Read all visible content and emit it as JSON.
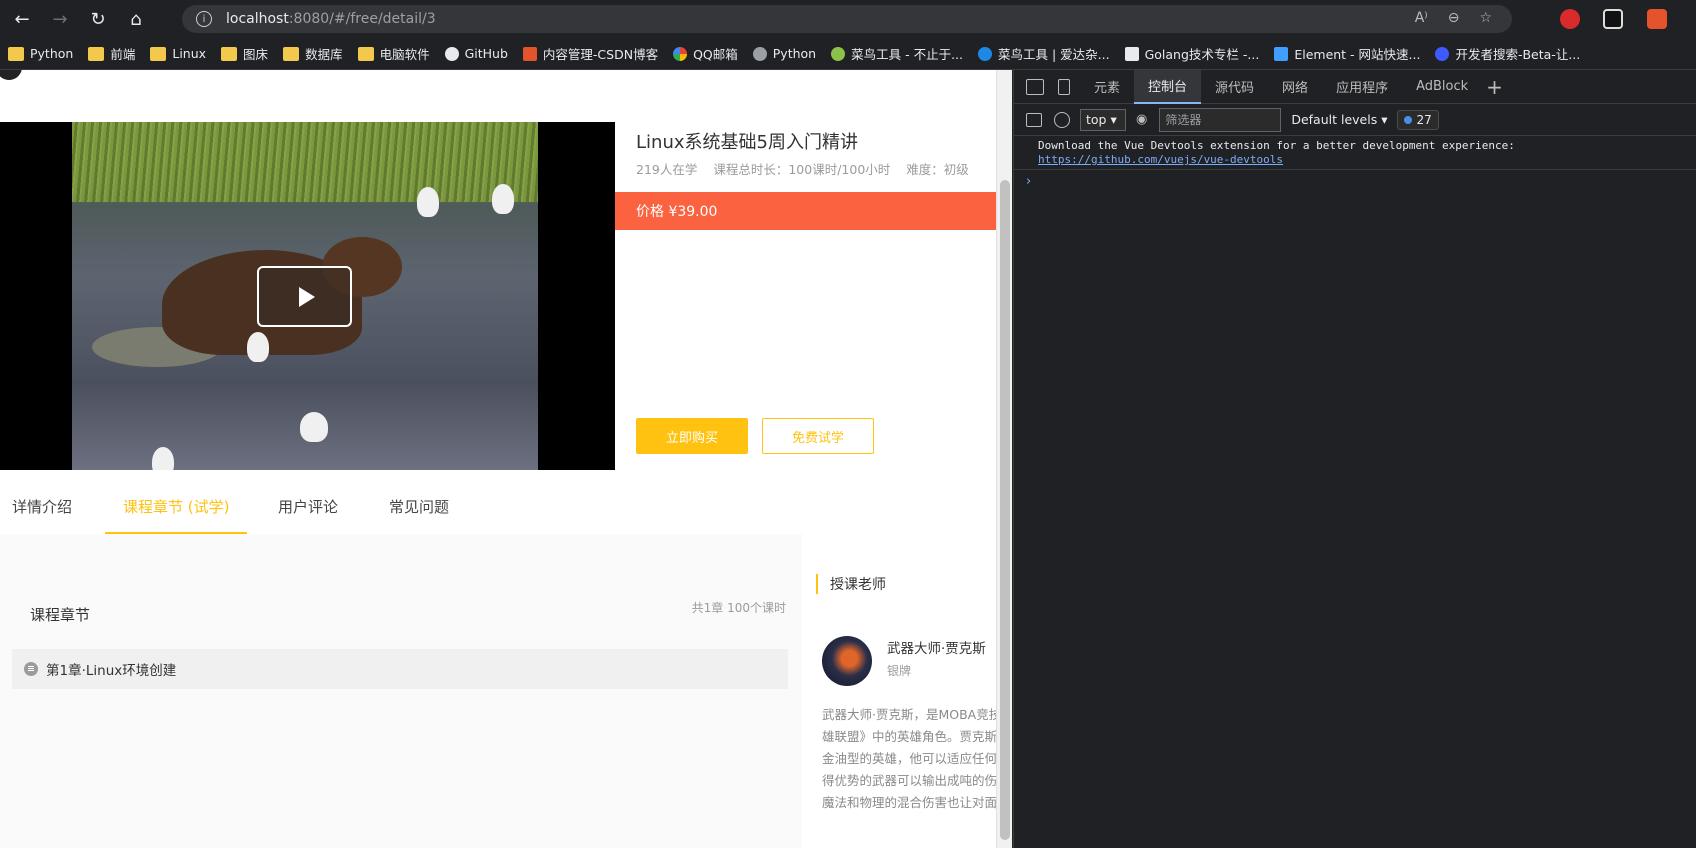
{
  "browser": {
    "url_host": "localhost",
    "url_rest": ":8080/#/free/detail/3"
  },
  "bookmarks": [
    {
      "label": "Python",
      "icon": "folder-icon"
    },
    {
      "label": "前端",
      "icon": "folder-icon"
    },
    {
      "label": "Linux",
      "icon": "folder-icon"
    },
    {
      "label": "图床",
      "icon": "folder-icon"
    },
    {
      "label": "数据库",
      "icon": "folder-icon"
    },
    {
      "label": "电脑软件",
      "icon": "folder-icon"
    },
    {
      "label": "GitHub",
      "icon": "github-icon"
    },
    {
      "label": "内容管理-CSDN博客",
      "icon": "csdn-icon"
    },
    {
      "label": "QQ邮箱",
      "icon": "qqmail-icon"
    },
    {
      "label": "Python",
      "icon": "python-icon"
    },
    {
      "label": "菜鸟工具 - 不止于...",
      "icon": "runoob-icon"
    },
    {
      "label": "菜鸟工具 | 爱达杂...",
      "icon": "aidazaza-icon"
    },
    {
      "label": "Golang技术专栏 -...",
      "icon": "golang-icon"
    },
    {
      "label": "Element - 网站快速...",
      "icon": "element-icon"
    },
    {
      "label": "开发者搜索-Beta-让...",
      "icon": "devsearch-icon"
    }
  ],
  "course": {
    "title": "Linux系统基础5周入门精讲",
    "students": "219人在学",
    "duration": "课程总时长：100课时/100小时",
    "difficulty": "难度：初级",
    "price": "价格 ¥39.00",
    "buy_label": "立即购买",
    "trial_label": "免费试学"
  },
  "tabs": [
    {
      "label": "详情介绍"
    },
    {
      "label": "课程章节 (试学)"
    },
    {
      "label": "用户评论"
    },
    {
      "label": "常见问题"
    }
  ],
  "chapters": {
    "heading": "课程章节",
    "count": "共1章 100个课时",
    "items": [
      {
        "label": "第1章·Linux环境创建"
      }
    ]
  },
  "teacher": {
    "heading": "授课老师",
    "name": "武器大师·贾克斯",
    "rank": "银牌",
    "desc_lines": [
      "武器大师·贾克斯，是MOBA竞技",
      "雄联盟》中的英雄角色。贾克斯",
      "金油型的英雄，他可以适应任何",
      "得优势的武器可以输出成吨的伤",
      "魔法和物理的混合伤害也让对面"
    ]
  },
  "devtools": {
    "tabs": [
      "元素",
      "控制台",
      "源代码",
      "网络",
      "应用程序",
      "AdBlock"
    ],
    "context": "top",
    "filter_placeholder": "筛选器",
    "levels": "Default levels",
    "message_count": "27",
    "message_text": "Download the Vue Devtools extension for a better development experience:",
    "message_link": "https://github.com/vuejs/vue-devtools",
    "prompt": "›"
  }
}
